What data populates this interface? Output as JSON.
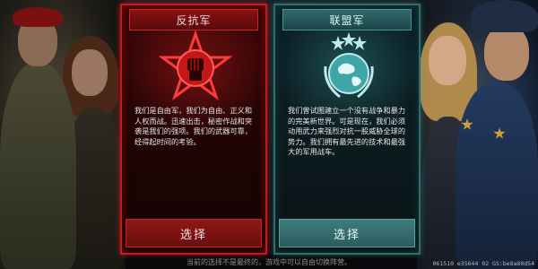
{
  "rebel": {
    "title": "反抗军",
    "description": "我们是自由军，我们为自由、正义和人权而战。迅速出击，秘密作战和突袭是我们的强项。我们的武器可靠，经得起时间的考验。",
    "select_label": "选择",
    "emblem_icon": "raised-fist-star-icon",
    "accent_color": "#c21c1c"
  },
  "alliance": {
    "title": "联盟军",
    "description": "我们曾试图建立一个没有战争和暴力的完美新世界。可是现在，我们必须动用武力来强烈对抗一股威胁全球的势力。我们拥有最先进的技术和最强大的军用战车。",
    "select_label": "选择",
    "emblem_icon": "globe-laurel-stars-icon",
    "accent_color": "#2f8a8c"
  },
  "footer": {
    "note": "当前的选择不是最终的，游戏中可以自由切换阵营。",
    "build_id": "061510 e35644 02 GS:be8a80d54"
  }
}
